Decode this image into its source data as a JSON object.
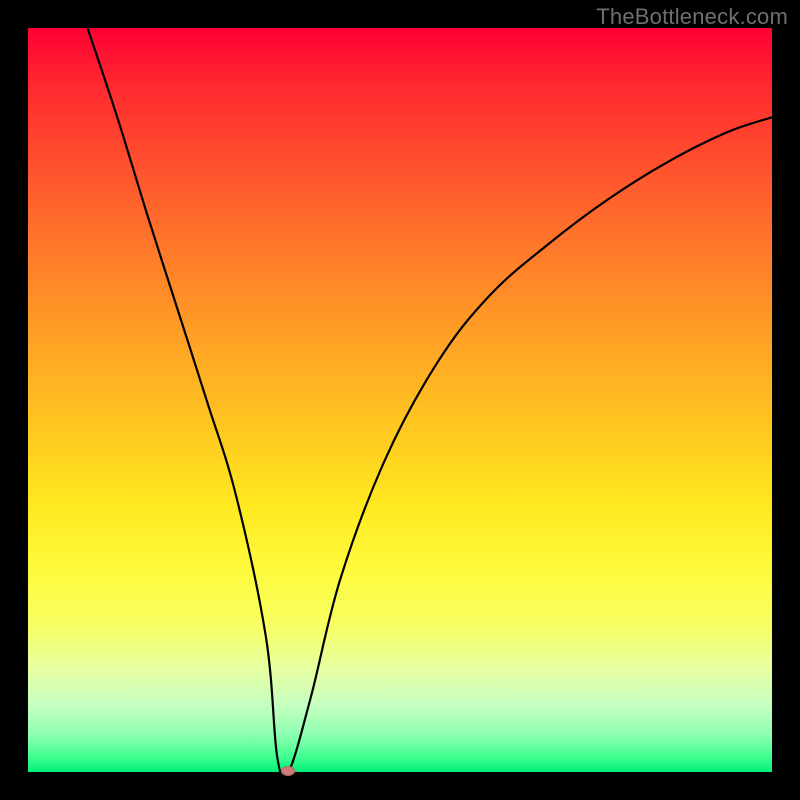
{
  "watermark": "TheBottleneck.com",
  "chart_data": {
    "type": "line",
    "title": "",
    "xlabel": "",
    "ylabel": "",
    "xlim": [
      0,
      100
    ],
    "ylim": [
      0,
      100
    ],
    "grid": false,
    "legend": false,
    "series": [
      {
        "name": "curve",
        "x": [
          8,
          12,
          16,
          20,
          24,
          28,
          32,
          33.5,
          35,
          38,
          42,
          48,
          55,
          62,
          70,
          78,
          86,
          94,
          100
        ],
        "y": [
          100,
          88,
          75,
          62.5,
          50,
          37,
          18,
          2,
          0,
          10,
          26,
          42,
          55,
          64,
          71,
          77,
          82,
          86,
          88
        ]
      }
    ],
    "minimum_marker": {
      "x": 35,
      "y": 0,
      "color": "#cf7a7a"
    },
    "background_gradient": {
      "top": "#ff0033",
      "bottom": "#00f078"
    }
  }
}
